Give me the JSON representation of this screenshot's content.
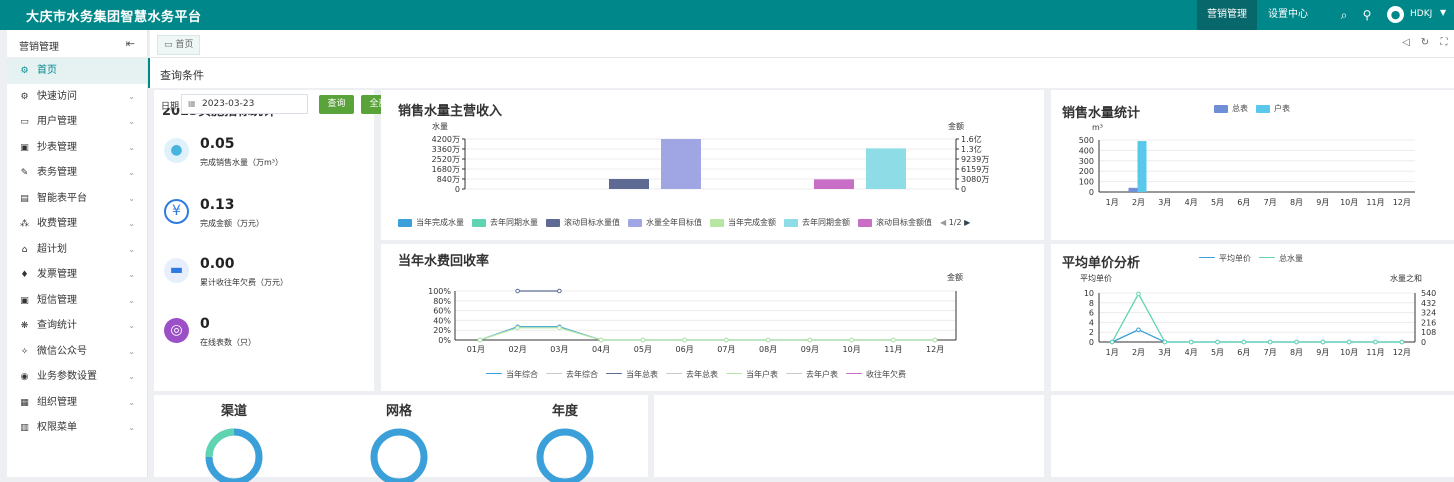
{
  "header": {
    "title": "大庆市水务集团智慧水务平台",
    "nav_active": "营销管理",
    "nav_settings": "设置中心",
    "user": "HDKJ"
  },
  "sidebar": {
    "title": "营销管理",
    "items": [
      {
        "label": "首页",
        "icon": "home-icon",
        "glyph": "⚙"
      },
      {
        "label": "快速访问",
        "icon": "gear-icon",
        "glyph": "⚙"
      },
      {
        "label": "用户管理",
        "icon": "monitor-icon",
        "glyph": "▭"
      },
      {
        "label": "抄表管理",
        "icon": "meter-icon",
        "glyph": "▣"
      },
      {
        "label": "表务管理",
        "icon": "edit-icon",
        "glyph": "✎"
      },
      {
        "label": "智能表平台",
        "icon": "smart-meter-icon",
        "glyph": "▤"
      },
      {
        "label": "收费管理",
        "icon": "fee-icon",
        "glyph": "⁂"
      },
      {
        "label": "超计划",
        "icon": "plan-icon",
        "glyph": "⌂"
      },
      {
        "label": "发票管理",
        "icon": "invoice-icon",
        "glyph": "♦"
      },
      {
        "label": "短信管理",
        "icon": "sms-icon",
        "glyph": "▣"
      },
      {
        "label": "查询统计",
        "icon": "stats-icon",
        "glyph": "❋"
      },
      {
        "label": "微信公众号",
        "icon": "wechat-icon",
        "glyph": "✧"
      },
      {
        "label": "业务参数设置",
        "icon": "params-icon",
        "glyph": "◉"
      },
      {
        "label": "组织管理",
        "icon": "org-icon",
        "glyph": "▦"
      },
      {
        "label": "权限菜单",
        "icon": "permission-icon",
        "glyph": "▥"
      }
    ]
  },
  "tabs": {
    "home": "首页"
  },
  "query": {
    "title": "查询条件",
    "date_label": "日期",
    "date_value": "2023-03-23",
    "query_button": "查询",
    "all_button": "全部"
  },
  "stats": {
    "title": "2023实施指标统计",
    "items": [
      {
        "value": "0.05",
        "label": "完成销售水量（万m³）",
        "icon": "water-drop-icon",
        "color": "#47b4e0"
      },
      {
        "value": "0.13",
        "label": "完成金额（万元）",
        "icon": "yen-icon",
        "color": "#ffffff"
      },
      {
        "value": "0.00",
        "label": "累计收往年欠费（万元）",
        "icon": "printer-icon",
        "color": "#2d7be0"
      },
      {
        "value": "0",
        "label": "在线表数（只）",
        "icon": "meter-dial-icon",
        "color": "#9c50c8"
      }
    ]
  },
  "sales_income": {
    "title": "销售水量主营收入",
    "left_axis_title": "水量",
    "right_axis_title": "金额",
    "left_ticks": [
      "0",
      "840万",
      "1680万",
      "2520万",
      "3360万",
      "4200万"
    ],
    "right_ticks": [
      "0",
      "3080万",
      "6159万",
      "9239万",
      "1.3亿",
      "1.6亿"
    ],
    "legend": [
      {
        "name": "当年完成水量",
        "color": "#3ba0d9"
      },
      {
        "name": "去年同期水量",
        "color": "#5fd4b2"
      },
      {
        "name": "滚动目标水量值",
        "color": "#5d6b94"
      },
      {
        "name": "水量全年目标值",
        "color": "#a0a6e4"
      },
      {
        "name": "当年完成金额",
        "color": "#b7e6a4"
      },
      {
        "name": "去年同期金额",
        "color": "#8edce6"
      },
      {
        "name": "滚动目标金额值",
        "color": "#c96ec6"
      }
    ],
    "pager": "1/2",
    "chart_data": {
      "type": "bar",
      "series": [
        {
          "name": "滚动目标水量值",
          "axis": "left",
          "value": 840
        },
        {
          "name": "水量全年目标值",
          "axis": "left",
          "value": 4200
        },
        {
          "name": "滚动目标金额值",
          "axis": "right",
          "value": 3080
        },
        {
          "name": "去年同期金额",
          "axis": "right",
          "value": 13000
        }
      ],
      "left_ylim": [
        0,
        4200
      ],
      "right_ylim": [
        0,
        16000
      ]
    }
  },
  "volume_stats": {
    "title": "销售水量统计",
    "unit": "m³",
    "legend": [
      {
        "name": "总表",
        "color": "#6e8fd6"
      },
      {
        "name": "户表",
        "color": "#5ac8ea"
      }
    ],
    "chart_data": {
      "type": "bar",
      "categories": [
        "1月",
        "2月",
        "3月",
        "4月",
        "5月",
        "6月",
        "7月",
        "8月",
        "9月",
        "10月",
        "11月",
        "12月"
      ],
      "series": [
        {
          "name": "总表",
          "values": [
            0,
            40,
            0,
            0,
            0,
            0,
            0,
            0,
            0,
            0,
            0,
            0
          ]
        },
        {
          "name": "户表",
          "values": [
            0,
            490,
            0,
            0,
            0,
            0,
            0,
            0,
            0,
            0,
            0,
            0
          ]
        }
      ],
      "yticks": [
        "0",
        "100",
        "200",
        "300",
        "400",
        "500"
      ],
      "ylim": [
        0,
        500
      ]
    }
  },
  "recovery": {
    "title": "当年水费回收率",
    "right_axis_title": "金额",
    "legend": [
      {
        "name": "当年综合",
        "color": "#3ba0d9"
      },
      {
        "name": "去年综合",
        "color": "#c8c8c8"
      },
      {
        "name": "当年总表",
        "color": "#5d6b94"
      },
      {
        "name": "去年总表",
        "color": "#c8c8c8"
      },
      {
        "name": "当年户表",
        "color": "#b7e6a4"
      },
      {
        "name": "去年户表",
        "color": "#c8c8c8"
      },
      {
        "name": "收往年欠费",
        "color": "#c96ec6"
      }
    ],
    "chart_data": {
      "type": "line",
      "categories": [
        "01月",
        "02月",
        "03月",
        "04月",
        "05月",
        "06月",
        "07月",
        "08月",
        "09月",
        "10月",
        "11月",
        "12月"
      ],
      "yticks": [
        "0%",
        "20%",
        "40%",
        "60%",
        "80%",
        "100%"
      ],
      "series": [
        {
          "name": "当年综合",
          "values": [
            0,
            27,
            27,
            0,
            0,
            0,
            0,
            0,
            0,
            0,
            0,
            0
          ]
        },
        {
          "name": "当年总表",
          "values": [
            null,
            100,
            100,
            null,
            null,
            null,
            null,
            null,
            null,
            null,
            null,
            null
          ]
        },
        {
          "name": "当年户表",
          "values": [
            0,
            25,
            25,
            0,
            0,
            0,
            0,
            0,
            0,
            0,
            0,
            0
          ]
        }
      ],
      "ylim": [
        0,
        100
      ]
    }
  },
  "unit_price": {
    "title": "平均单价分析",
    "left_axis_title": "平均单价",
    "right_axis_title": "水量之和",
    "legend": [
      {
        "name": "平均单价",
        "color": "#3ba0d9"
      },
      {
        "name": "总水量",
        "color": "#5fd4b2"
      }
    ],
    "chart_data": {
      "type": "line",
      "categories": [
        "1月",
        "2月",
        "3月",
        "4月",
        "5月",
        "6月",
        "7月",
        "8月",
        "9月",
        "10月",
        "11月",
        "12月"
      ],
      "left_ticks": [
        "0",
        "2",
        "4",
        "6",
        "8",
        "10"
      ],
      "right_ticks": [
        "0",
        "108",
        "216",
        "324",
        "432",
        "540"
      ],
      "series": [
        {
          "name": "平均单价",
          "axis": "left",
          "values": [
            0,
            2.5,
            0,
            0,
            0,
            0,
            0,
            0,
            0,
            0,
            0,
            0
          ]
        },
        {
          "name": "总水量",
          "axis": "right",
          "values": [
            0,
            530,
            0,
            0,
            0,
            0,
            0,
            0,
            0,
            0,
            0,
            0
          ]
        }
      ],
      "left_ylim": [
        0,
        10
      ],
      "right_ylim": [
        0,
        540
      ]
    }
  },
  "donuts": [
    {
      "title": "渠道",
      "color": "#3ba0d9",
      "accent": "#5fd4b2"
    },
    {
      "title": "网格",
      "color": "#3ba0d9",
      "accent": "#3ba0d9"
    },
    {
      "title": "年度",
      "color": "#3ba0d9",
      "accent": "#3ba0d9"
    }
  ]
}
